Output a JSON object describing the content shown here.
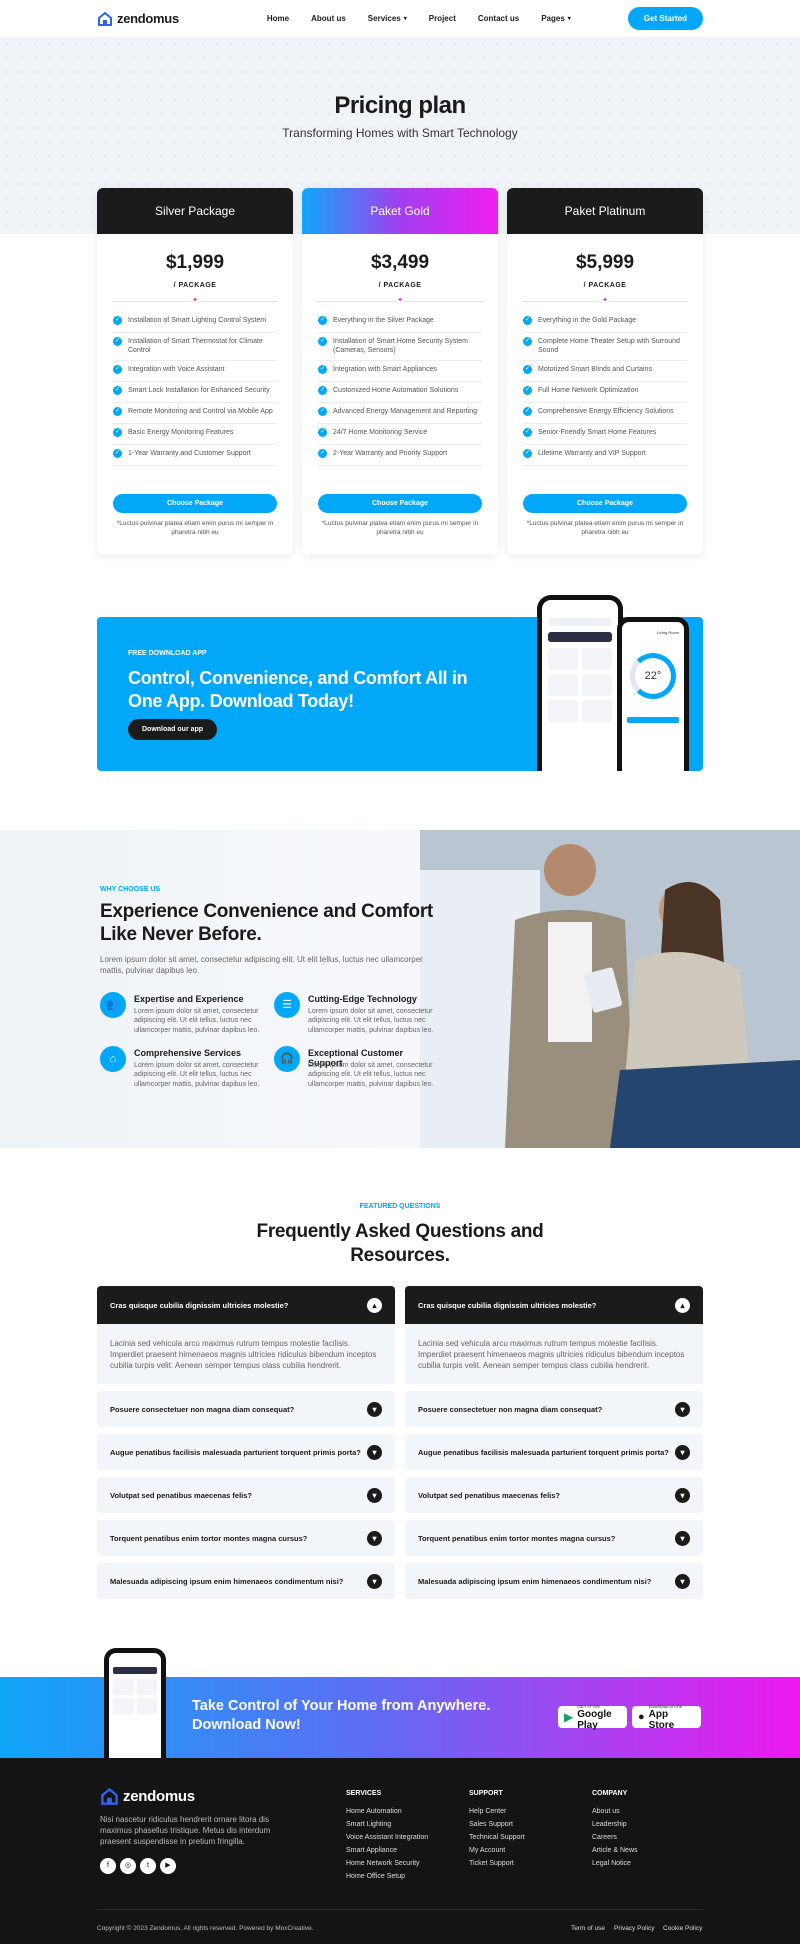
{
  "brand": {
    "name": "zendomus",
    "accent": "#02a8f7"
  },
  "nav": {
    "items": [
      "Home",
      "About us",
      "Services",
      "Project",
      "Contact us",
      "Pages"
    ],
    "cta": "Get Started"
  },
  "pricing": {
    "title": "Pricing plan",
    "subtitle": "Transforming Homes with Smart Technology",
    "cards": [
      {
        "name": "Silver Package",
        "price": "$1,999",
        "per": "/ PACKAGE",
        "features": [
          "Installation of Smart Lighting Control System",
          "Installation of Smart Thermostat for Climate Control",
          "Integration with Voice Assistant",
          "Smart Lock Installation for Enhanced Security",
          "Remote Monitoring and Control via Mobile App",
          "Basic Energy Monitoring Features",
          "1-Year Warranty and Customer Support"
        ],
        "button": "Choose Package",
        "note": "*Luctus pulvinar platea etiam enim purus mi semper in pharetra nibh eu"
      },
      {
        "name": "Paket Gold",
        "price": "$3,499",
        "per": "/ PACKAGE",
        "features": [
          "Everything in the Silver Package",
          "Installation of Smart Home Security System (Cameras, Sensors)",
          "Integration with Smart Appliances",
          "Customized Home Automation Solutions",
          "Advanced Energy Management and Reporting",
          "24/7 Home Monitoring Service",
          "2-Year Warranty and Priority Support"
        ],
        "button": "Choose Package",
        "note": "*Luctus pulvinar platea etiam enim purus mi semper in pharetra nibh eu"
      },
      {
        "name": "Paket Platinum",
        "price": "$5,999",
        "per": "/ PACKAGE",
        "features": [
          "Everything in the Gold Package",
          "Complete Home Theater Setup with Surround Sound",
          "Motorized Smart Blinds and Curtains",
          "Full Home Network Optimization",
          "Comprehensive Energy Efficiency Solutions",
          "Senior-Friendly Smart Home Features",
          "Lifetime Warranty and VIP Support"
        ],
        "button": "Choose Package",
        "note": "*Luctus pulvinar platea etiam enim purus mi semper in pharetra nibh eu"
      }
    ]
  },
  "app": {
    "kicker": "FREE DOWNLOAD APP",
    "heading": "Control, Convenience, and Comfort All in One App. Download Today!",
    "button": "Download our app",
    "phone_temp": "22°",
    "phone_room": "Living Room"
  },
  "why": {
    "kicker": "WHY CHOOSE US",
    "heading": "Experience Convenience and Comfort Like Never Before.",
    "text": "Lorem ipsum dolor sit amet, consectetur adipiscing elit. Ut elit tellus, luctus nec ullamcorper mattis, pulvinar dapibus leo.",
    "items": [
      {
        "title": "Expertise and Experience",
        "desc": "Lorem ipsum dolor sit amet, consectetur adipiscing elit. Ut elit tellus, luctus nec ullamcorper mattis, pulvinar dapibus leo."
      },
      {
        "title": "Cutting-Edge Technology",
        "desc": "Lorem ipsum dolor sit amet, consectetur adipiscing elit. Ut elit tellus, luctus nec ullamcorper mattis, pulvinar dapibus leo."
      },
      {
        "title": "Comprehensive Services",
        "desc": "Lorem ipsum dolor sit amet, consectetur adipiscing elit. Ut elit tellus, luctus nec ullamcorper mattis, pulvinar dapibus leo."
      },
      {
        "title": "Exceptional Customer Support",
        "desc": "Lorem ipsum dolor sit amet, consectetur adipiscing elit. Ut elit tellus, luctus nec ullamcorper mattis, pulvinar dapibus leo."
      }
    ]
  },
  "faq": {
    "kicker": "FEATURED QUESTIONS",
    "heading": "Frequently Asked Questions and Resources.",
    "open_q": "Cras quisque cubilia dignissim ultricies molestie?",
    "open_a": "Lacinia sed vehicula arcu maximus rutrum tempus molestie facilisis. Imperdiet praesent himenaeos magnis ultricies ridiculus bibendum inceptos cubilia turpis velit. Aenean semper tempus class cubilia hendrerit.",
    "questions": [
      "Posuere consectetuer non magna diam consequat?",
      "Augue penatibus facilisis malesuada parturient torquent primis porta?",
      "Volutpat sed penatibus maecenas felis?",
      "Torquent penatibus enim tortor montes magna cursus?",
      "Malesuada adipiscing ipsum enim himenaeos condimentum nisi?"
    ]
  },
  "cta": {
    "heading": "Take Control of Your Home from Anywhere. Download Now!",
    "gp_small": "GET IT ON",
    "gp_big": "Google Play",
    "as_small": "Download on the",
    "as_big": "App Store"
  },
  "footer": {
    "about": "Nisi nascetur ridiculus hendrerit ornare litora dis maximus phasellus tristique. Metus dis interdum praesent suspendisse in pretium fringilla.",
    "services_title": "SERVICES",
    "services": [
      "Home Automation",
      "Smart Lighting",
      "Voice Assistant Integration",
      "Smart Appliance",
      "Home Network Security",
      "Home Office Setup"
    ],
    "support_title": "SUPPORT",
    "support": [
      "Help Center",
      "Sales Support",
      "Technical Support",
      "My Account",
      "Ticket Support"
    ],
    "company_title": "COMPANY",
    "company": [
      "About us",
      "Leadership",
      "Careers",
      "Article & News",
      "Legal Notice"
    ],
    "copyright": "Copyright © 2023 Zendomus, All rights reserved. Powered by MoxCreative.",
    "legal": [
      "Term of use",
      "Privacy Policy",
      "Cookie Policy"
    ]
  }
}
